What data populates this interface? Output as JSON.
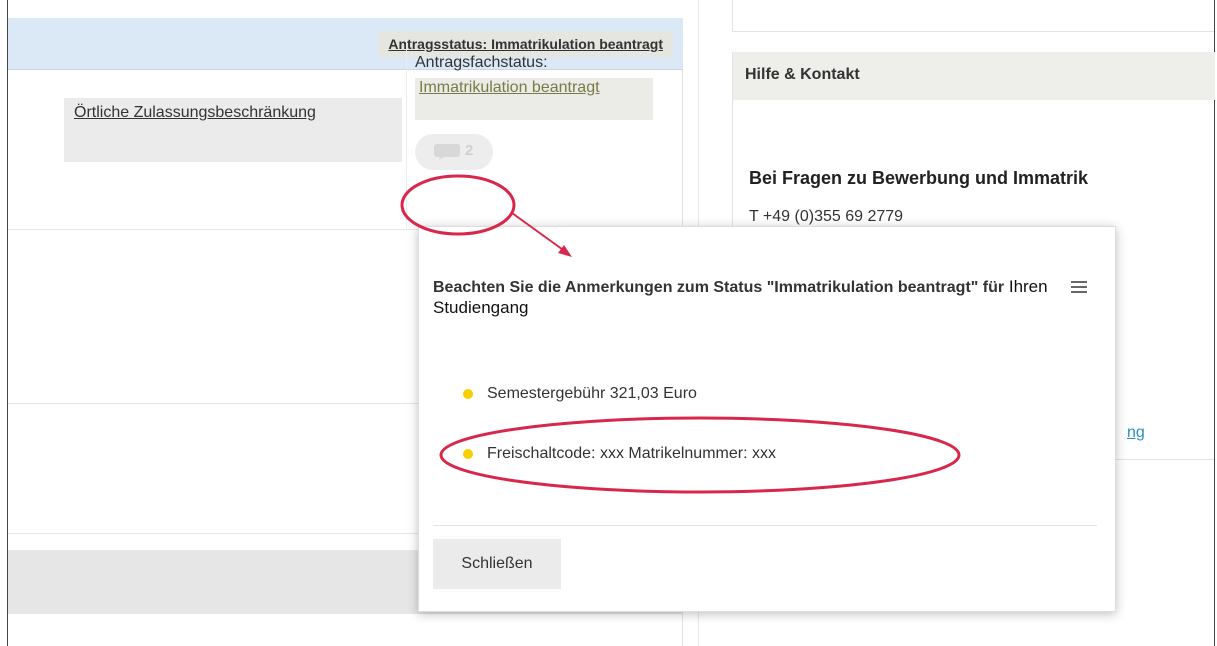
{
  "main": {
    "status_pill": "Antragsstatus: Immatrikulation beantragt",
    "restriction_label": "Örtliche Zulassungsbeschränkung",
    "status_cell": {
      "label": "Antragsfachstatus:",
      "value": "Immatrikulation beantragt",
      "comment_count": "2"
    }
  },
  "sidebar": {
    "help_title": "Hilfe & Kontakt",
    "question": "Bei Fragen zu Bewerbung und Immatrik",
    "phone": "T +49 (0)355 69 2779",
    "link_fragment": "ng"
  },
  "popup": {
    "title_bold": "Beachten Sie die Anmerkungen zum Status \"Immatrikulation beantragt\" für",
    "title_normal": " Ihren Studiengang",
    "items": [
      "Semestergebühr 321,03 Euro",
      "Freischaltcode: xxx Matrikelnummer: xxx"
    ],
    "close_label": "Schließen"
  },
  "colors": {
    "header_blue": "#dbe8f5",
    "bullet_yellow": "#f5cf00",
    "annotation_red": "#d8274a",
    "link_blue": "#2a8fc0"
  }
}
